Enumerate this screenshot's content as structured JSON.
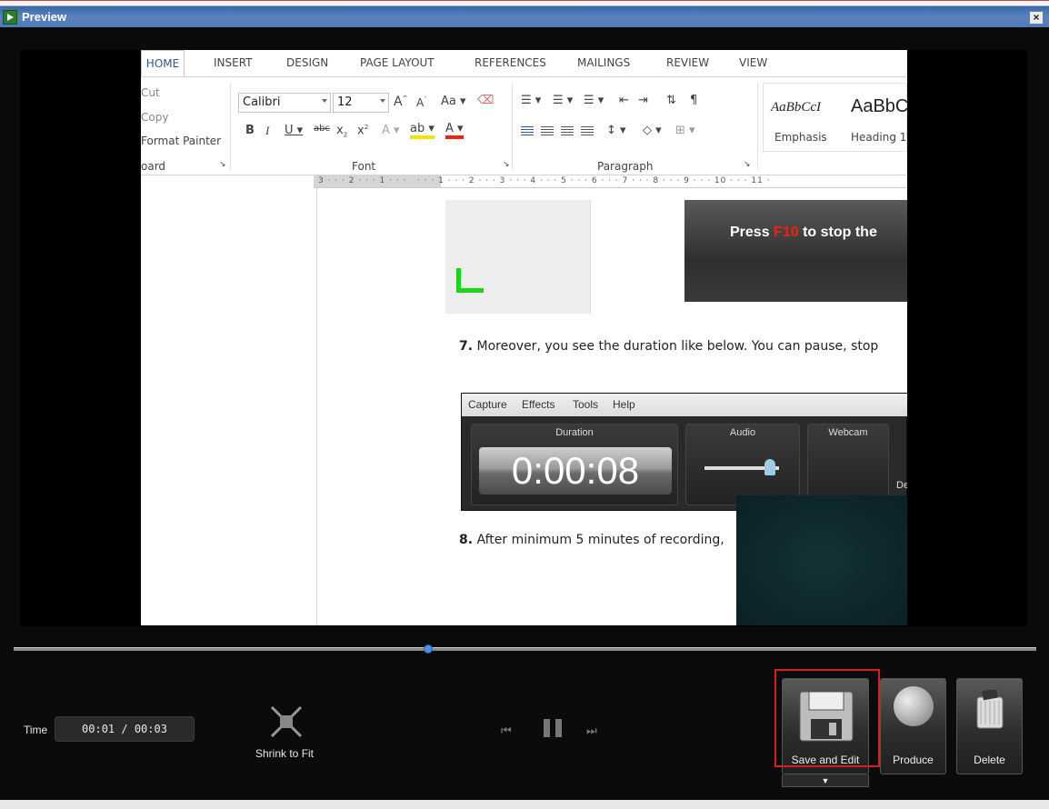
{
  "window": {
    "title": "Preview",
    "close": "×"
  },
  "doc": {
    "tabs": [
      "HOME",
      "INSERT",
      "DESIGN",
      "PAGE LAYOUT",
      "REFERENCES",
      "MAILINGS",
      "REVIEW",
      "VIEW"
    ],
    "clipboard": {
      "cut": "Cut",
      "copy": "Copy",
      "format_painter": "Format Painter",
      "group": "oard"
    },
    "font": {
      "name": "Calibri",
      "size": "12",
      "group": "Font",
      "change_case": "Aa"
    },
    "paragraph": {
      "group": "Paragraph"
    },
    "styles": {
      "emphasis_sample": "AaBbCcI",
      "heading_sample": "AaBbC",
      "emphasis": "Emphasis",
      "heading1": "Heading 1"
    },
    "ruler": "3 · · · 2 · · · 1 · · ·   · · · 1 · · · 2 · · · 3 · · · 4 · · · 5 · · · 6 · · · 7 · · · 8 · · · 9 · · · 10 · · · 11 ·",
    "banner": {
      "press": "Press ",
      "key": "F10",
      "rest": " to stop the"
    },
    "step7": {
      "num": "7.",
      "text": " Moreover, you see the duration like below. You can pause, stop"
    },
    "step8": {
      "num": "8.",
      "text": " After minimum 5 minutes of recording,"
    },
    "recorder": {
      "menus": [
        "Capture",
        "Effects",
        "Tools",
        "Help"
      ],
      "duration_label": "Duration",
      "duration": "0:00:08",
      "audio_label": "Audio",
      "webcam_label": "Webcam",
      "extra": "De"
    }
  },
  "player": {
    "time_label": "Time",
    "time_value": "00:01  /  00:03",
    "shrink_label": "Shrink to Fit",
    "save_edit_label": "Save and Edit",
    "produce_label": "Produce",
    "delete_label": "Delete",
    "save_arrow": "▼",
    "prev": "⏮",
    "next": "⏭"
  }
}
